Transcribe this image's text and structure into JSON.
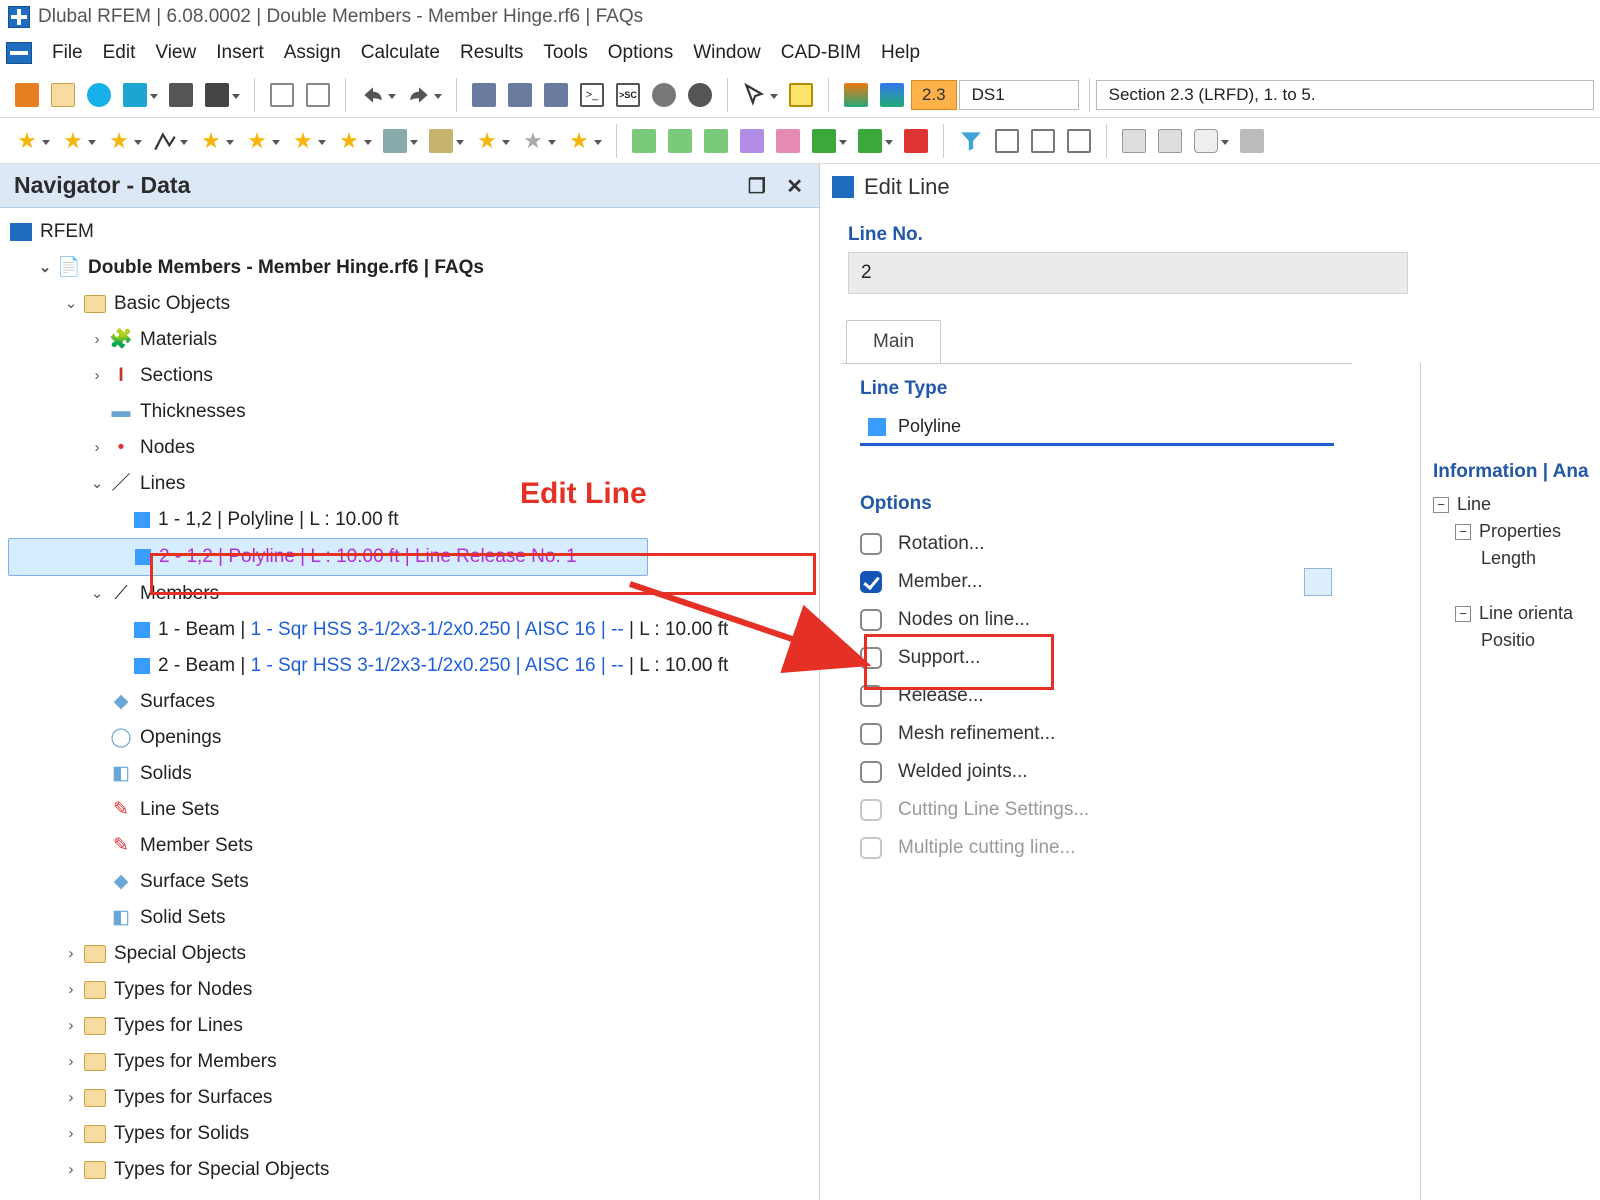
{
  "title": "Dlubal RFEM | 6.08.0002 | Double Members - Member Hinge.rf6 | FAQs",
  "menu": [
    "File",
    "Edit",
    "View",
    "Insert",
    "Assign",
    "Calculate",
    "Results",
    "Tools",
    "Options",
    "Window",
    "CAD-BIM",
    "Help"
  ],
  "toolbar1": {
    "badge": "2.3",
    "combo": "DS1",
    "section": "Section 2.3 (LRFD), 1. to 5."
  },
  "navigator": {
    "title": "Navigator - Data",
    "root": "RFEM",
    "project": "Double Members - Member Hinge.rf6 | FAQs",
    "basic": "Basic Objects",
    "materials": "Materials",
    "sections": "Sections",
    "thicknesses": "Thicknesses",
    "nodes": "Nodes",
    "lines": "Lines",
    "line1": "1 - 1,2 | Polyline | L : 10.00 ft",
    "line2": "2 - 1,2 | Polyline | L : 10.00 ft | Line Release No. 1",
    "members": "Members",
    "member1a": "1 - Beam | ",
    "member1b": "1 - Sqr HSS 3-1/2x3-1/2x0.250 | AISC 16 | --",
    "member1c": " | L : 10.00 ft",
    "member2a": "2 - Beam | ",
    "member2b": "1 - Sqr HSS 3-1/2x3-1/2x0.250 | AISC 16 | --",
    "member2c": " | L : 10.00 ft",
    "surfaces": "Surfaces",
    "openings": "Openings",
    "solids": "Solids",
    "linesets": "Line Sets",
    "membersets": "Member Sets",
    "surfacesets": "Surface Sets",
    "solidsets": "Solid Sets",
    "folders": [
      "Special Objects",
      "Types for Nodes",
      "Types for Lines",
      "Types for Members",
      "Types for Surfaces",
      "Types for Solids",
      "Types for Special Objects"
    ]
  },
  "annotation": {
    "edit_line": "Edit Line"
  },
  "editline": {
    "title": "Edit Line",
    "lineno_label": "Line No.",
    "lineno": "2",
    "tab": "Main",
    "linetype_label": "Line Type",
    "linetype": "Polyline",
    "options_label": "Options",
    "opts": {
      "rotation": "Rotation...",
      "member": "Member...",
      "nodes": "Nodes on line...",
      "support": "Support...",
      "release": "Release...",
      "mesh": "Mesh refinement...",
      "welded": "Welded joints...",
      "cutting": "Cutting Line Settings...",
      "multi": "Multiple cutting line..."
    }
  },
  "info": {
    "header": "Information | Ana",
    "line": "Line",
    "properties": "Properties",
    "length": "Length",
    "orient": "Line orienta",
    "pos": "Positio"
  }
}
